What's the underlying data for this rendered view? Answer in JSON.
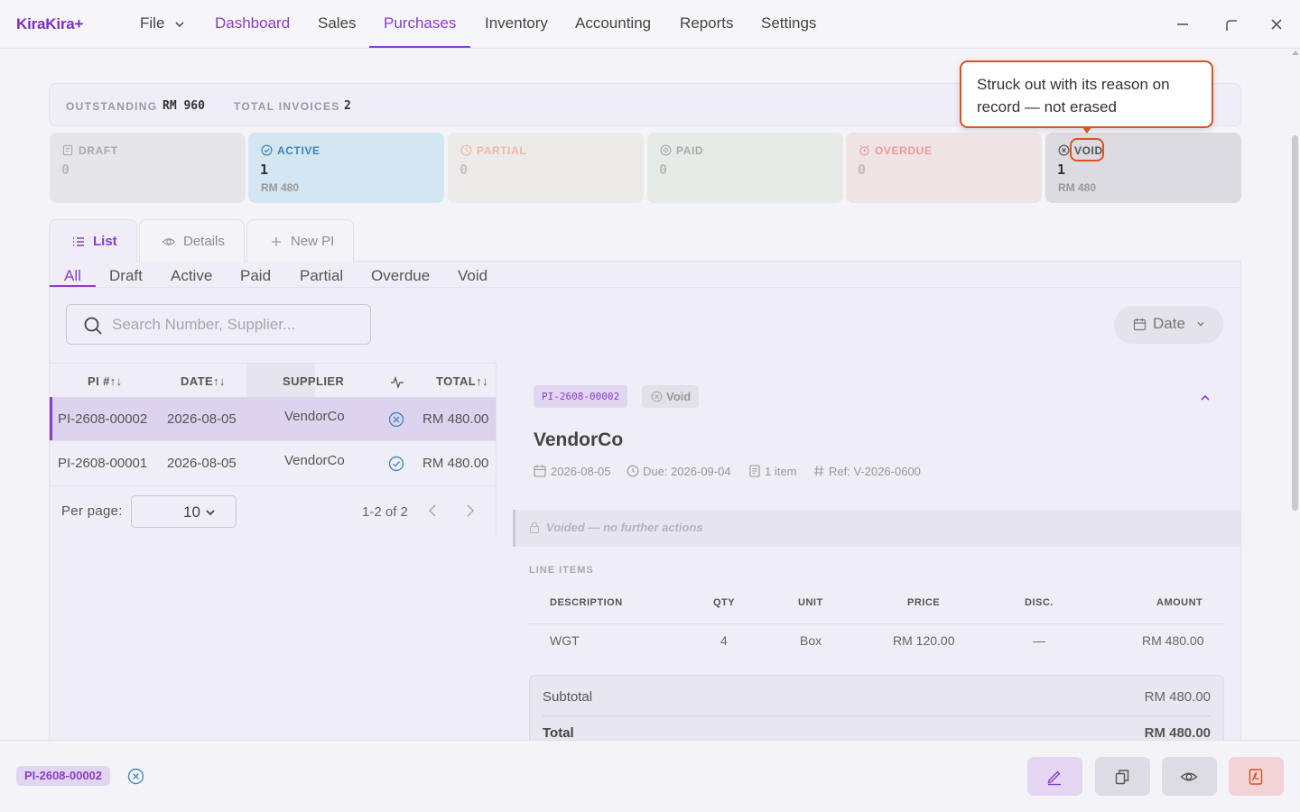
{
  "app": {
    "name": "KiraKira+"
  },
  "nav": {
    "file": "File",
    "items": [
      "Dashboard",
      "Sales",
      "Purchases",
      "Inventory",
      "Accounting",
      "Reports",
      "Settings"
    ],
    "active": "Purchases"
  },
  "summary": {
    "outstanding_label": "OUTSTANDING",
    "outstanding_value": "RM 960",
    "total_invoices_label": "TOTAL INVOICES",
    "total_invoices_value": "2"
  },
  "status_cards": [
    {
      "label": "DRAFT",
      "count": "0",
      "amount": "",
      "icon": "draft-icon"
    },
    {
      "label": "ACTIVE",
      "count": "1",
      "amount": "RM 480",
      "icon": "check-circle-icon"
    },
    {
      "label": "PARTIAL",
      "count": "0",
      "amount": "",
      "icon": "clock-icon"
    },
    {
      "label": "PAID",
      "count": "0",
      "amount": "",
      "icon": "paid-icon"
    },
    {
      "label": "OVERDUE",
      "count": "0",
      "amount": "",
      "icon": "alarm-icon"
    },
    {
      "label": "VOID",
      "count": "1",
      "amount": "RM 480",
      "icon": "void-icon"
    }
  ],
  "tooltip": {
    "text": "Struck out with its reason on record — not erased"
  },
  "view_tabs": {
    "list": "List",
    "details": "Details",
    "new": "New PI"
  },
  "filter_tabs": [
    "All",
    "Draft",
    "Active",
    "Paid",
    "Partial",
    "Overdue",
    "Void"
  ],
  "search": {
    "placeholder": "Search Number, Supplier..."
  },
  "date_filter": "Date",
  "table": {
    "headers": {
      "number": "PI #↑↓",
      "date": "DATE↑↓",
      "supplier": "SUPPLIER",
      "total": "TOTAL↑↓"
    },
    "rows": [
      {
        "number": "PI-2608-00002",
        "date": "2026-08-05",
        "supplier": "VendorCo",
        "status": "void",
        "total": "RM 480.00"
      },
      {
        "number": "PI-2608-00001",
        "date": "2026-08-05",
        "supplier": "VendorCo",
        "status": "active",
        "total": "RM 480.00"
      }
    ]
  },
  "pagination": {
    "per_page_label": "Per page:",
    "per_page": "10",
    "range": "1-2 of 2"
  },
  "detail": {
    "number": "PI-2608-00002",
    "status": "Void",
    "vendor": "VendorCo",
    "date": "2026-08-05",
    "due": "Due: 2026-09-04",
    "items": "1 item",
    "ref": "Ref: V-2026-0600",
    "voided_note": "Voided — no further actions",
    "line_items_label": "LINE ITEMS",
    "line_headers": {
      "description": "DESCRIPTION",
      "qty": "QTY",
      "unit": "UNIT",
      "price": "PRICE",
      "disc": "DISC.",
      "amount": "AMOUNT"
    },
    "lines": [
      {
        "description": "WGT",
        "qty": "4",
        "unit": "Box",
        "price": "RM 120.00",
        "disc": "—",
        "amount": "RM 480.00"
      }
    ],
    "subtotal_label": "Subtotal",
    "subtotal": "RM 480.00",
    "total_label": "Total",
    "total": "RM 480.00"
  },
  "bottom": {
    "selected": "PI-2608-00002"
  },
  "colors": {
    "accent": "#8a3dc7",
    "highlight": "#d9541e",
    "pdf": "#f3d2d8"
  }
}
